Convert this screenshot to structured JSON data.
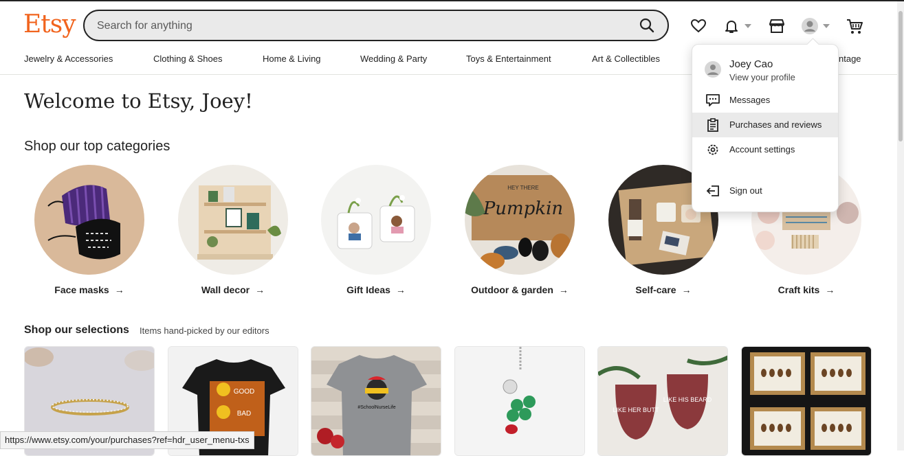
{
  "brand": {
    "logo_text": "Etsy",
    "accent": "#f1641e"
  },
  "search": {
    "placeholder": "Search for anything",
    "value": ""
  },
  "header_icons": [
    "heart-icon",
    "bell-icon",
    "shop-icon",
    "avatar-icon",
    "cart-icon"
  ],
  "nav": {
    "items": [
      {
        "label": "Jewelry & Accessories"
      },
      {
        "label": "Clothing & Shoes"
      },
      {
        "label": "Home & Living"
      },
      {
        "label": "Wedding & Party"
      },
      {
        "label": "Toys & Entertainment"
      },
      {
        "label": "Art & Collectibles"
      },
      {
        "label": "ntage"
      }
    ]
  },
  "main": {
    "welcome": "Welcome to Etsy, Joey!",
    "categories_title": "Shop our top categories",
    "categories": [
      {
        "label": "Face masks"
      },
      {
        "label": "Wall decor"
      },
      {
        "label": "Gift Ideas"
      },
      {
        "label": "Outdoor & garden"
      },
      {
        "label": "Self-care"
      },
      {
        "label": "Craft kits"
      }
    ],
    "pumpkin_mat": {
      "line1": "HEY THERE",
      "line2": "Pumpkin"
    },
    "selections_title": "Shop our selections",
    "selections_subtitle": "Items hand-picked by our editors",
    "selections": [
      {
        "name": "ring"
      },
      {
        "name": "tshirt",
        "text": [
          "GOOD",
          "BAD"
        ]
      },
      {
        "name": "grey-tshirt",
        "text": "#SchoolNurseLife"
      },
      {
        "name": "keychain"
      },
      {
        "name": "wine-glasses",
        "text_left": "LIKE HER BUTT",
        "text_right": "LIKE HIS BEARD"
      },
      {
        "name": "framed-art"
      }
    ]
  },
  "user_menu": {
    "name": "Joey Cao",
    "view_profile": "View your profile",
    "items": [
      {
        "label": "Messages",
        "icon": "messages-icon"
      },
      {
        "label": "Purchases and reviews",
        "icon": "clipboard-icon",
        "highlighted": true
      },
      {
        "label": "Account settings",
        "icon": "gear-icon"
      },
      {
        "label": "Sign out",
        "icon": "sign-out-icon"
      }
    ]
  },
  "status_bar": {
    "url": "https://www.etsy.com/your/purchases?ref=hdr_user_menu-txs"
  }
}
